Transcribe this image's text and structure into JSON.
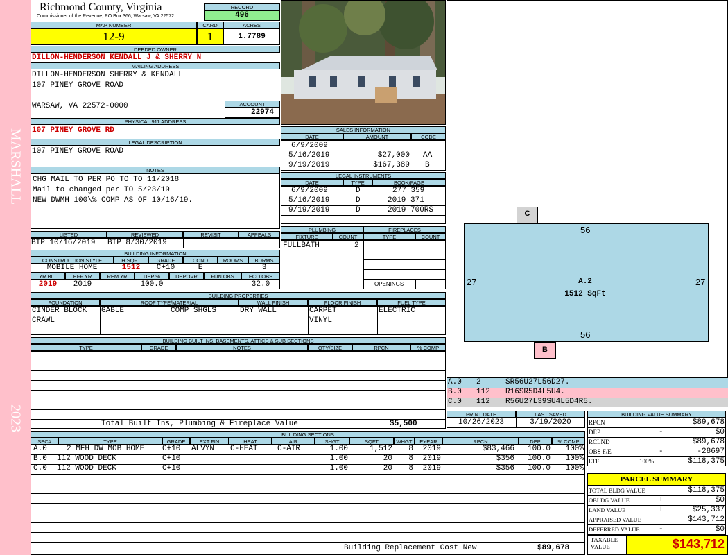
{
  "sidebar": {
    "district": "MARSHALL",
    "year": "2023",
    "color": "#ffc0cb"
  },
  "header": {
    "county": "Richmond County, Virginia",
    "commissioner": "Commissioner of the Revenue, PO Box 366, Warsaw, VA 22572",
    "record_label": "RECORD",
    "record": "496",
    "map_label": "MAP NUMBER",
    "map": "12-9",
    "card_label": "CARD",
    "card": "1",
    "acres_label": "ACRES",
    "acres": "1.7789"
  },
  "owner": {
    "deeded_label": "DEEDED OWNER",
    "deeded": "DILLON-HENDERSON KENDALL J & SHERRY N",
    "mailing_label": "MAILING ADDRESS",
    "line1": "DILLON-HENDERSON SHERRY & KENDALL",
    "line2": "107 PINEY GROVE ROAD",
    "line3": "WARSAW, VA 22572-0000",
    "account_label": "ACCOUNT",
    "account": "22974",
    "physical_label": "PHYSICAL 911 ADDRESS",
    "physical": "107 PINEY GROVE RD",
    "legal_label": "LEGAL DESCRIPTION",
    "legal": "107 PINEY GROVE ROAD"
  },
  "notes": {
    "label": "NOTES",
    "lines": [
      "CHG MAIL TO PER PO TO TO 11/2018",
      "Mail to changed per TO 5/23/19",
      "NEW DWMH 100\\% COMP AS OF 10/16/19."
    ]
  },
  "listing": {
    "listed_label": "LISTED",
    "listed": "BTP 10/16/2019",
    "reviewed_label": "REVIEWED",
    "reviewed": "BTP  8/30/2019",
    "revisit_label": "REVISIT",
    "appeals_label": "APPEALS"
  },
  "building_info": {
    "label": "BUILDING INFORMATION",
    "h1": [
      "CONSTRUCTION STYLE",
      "H SQFT",
      "GRADE",
      "COND",
      "ROOMS",
      "BDRMS"
    ],
    "v1": [
      "MOBILE HOME",
      "1512",
      "C+10",
      "E",
      "",
      "3"
    ],
    "h2": [
      "YR BLT",
      "EFF YR",
      "REM YR",
      "DEP %",
      "DEPOVR",
      "FUN OBS",
      "ECO OBS"
    ],
    "v2": [
      "2019",
      "2019",
      "",
      "100.0",
      "",
      "",
      "32.0"
    ]
  },
  "sales": {
    "label": "SALES INFORMATION",
    "cols": [
      "DATE",
      "AMOUNT",
      "CODE"
    ],
    "rows": [
      [
        "6/9/2009",
        "",
        ""
      ],
      [
        "5/16/2019",
        "$27,000",
        "AA"
      ],
      [
        "9/19/2019",
        "$167,389",
        "B"
      ]
    ]
  },
  "instruments": {
    "label": "LEGAL INSTRUMENTS",
    "cols": [
      "DATE",
      "TYPE",
      "BOOK/PAGE"
    ],
    "rows": [
      [
        "6/9/2009",
        "D",
        "277 359"
      ],
      [
        "5/16/2019",
        "D",
        "2019 371"
      ],
      [
        "9/19/2019",
        "D",
        "2019 700RS"
      ]
    ]
  },
  "plumbing": {
    "label": "PLUMBING",
    "cols": [
      "FIXTURE",
      "COUNT"
    ],
    "fixture": "FULLBATH",
    "count": "2"
  },
  "fireplaces": {
    "label": "FIREPLACES",
    "cols": [
      "TYPE",
      "COUNT"
    ],
    "openings": "OPENINGS"
  },
  "properties": {
    "label": "BUILDING PROPERTIES",
    "cols": [
      "FOUNDATION",
      "ROOF TYPE/MATERIAL",
      "WALL FINISH",
      "FLOOR FINISH",
      "FUEL TYPE"
    ],
    "foundation": [
      "CINDER BLOCK",
      "CRAWL"
    ],
    "roof_type": "GABLE",
    "roof_material": "COMP SHGLS",
    "wall": "DRY WALL",
    "floor": [
      "CARPET",
      "VINYL"
    ],
    "fuel": "ELECTRIC"
  },
  "builtins": {
    "label": "BUILDING BUILT INS, BASEMENTS, ATTICS & SUB SECTIONS",
    "cols": [
      "TYPE",
      "GRADE",
      "NOTES",
      "QTY/SIZE",
      "RPCN",
      "% COMP"
    ],
    "total_label": "Total Built Ins, Plumbing & Fireplace Value",
    "total": "$5,500"
  },
  "sections": {
    "label": "BUILDING SECTIONS",
    "cols": [
      "SEC#",
      "TYPE",
      "GRADE",
      "EXT FIN",
      "HEAT",
      "AIR",
      "SHGT",
      "SQFT",
      "WHGT",
      "EYEAR",
      "RPCN",
      "DEP",
      "% COMP"
    ],
    "rows": [
      [
        "A.0",
        "2 MFH DW MOB HOME",
        "C+10",
        "ALVYN",
        "C-HEAT",
        "C-AIR",
        "1.00",
        "1,512",
        "8",
        "2019",
        "$83,466",
        "100.0",
        "100%"
      ],
      [
        "B.0",
        "112 WOOD DECK",
        "",
        "C+10",
        "",
        "",
        "1.00",
        "20",
        "8",
        "2019",
        "$356",
        "100.0",
        "100%"
      ],
      [
        "C.0",
        "112 WOOD DECK",
        "",
        "C+10",
        "",
        "",
        "1.00",
        "20",
        "8",
        "2019",
        "$356",
        "100.0",
        "100%"
      ]
    ],
    "replacement_label": "Building Replacement Cost New",
    "replacement": "$89,678"
  },
  "sketch": {
    "c_label": "C",
    "b_label": "B",
    "top": "56",
    "bottom": "56",
    "left": "27",
    "right": "27",
    "area": "A.2",
    "sqft": "1512 SqFt",
    "legend": [
      {
        "sec": "A.0",
        "num": "2",
        "code": "SR56U27L56D27."
      },
      {
        "sec": "B.0",
        "num": "112",
        "code": "R16SR5D4L5U4."
      },
      {
        "sec": "C.0",
        "num": "112",
        "code": "R56U27L39SU4L5D4R5."
      }
    ]
  },
  "dates": {
    "print_label": "PRINT DATE",
    "print": "10/26/2023",
    "saved_label": "LAST SAVED",
    "saved": "3/19/2020"
  },
  "value_summary": {
    "label": "BUILDING VALUE SUMMARY",
    "rows": [
      {
        "k": "RPCN",
        "s": "",
        "v": "$89,678"
      },
      {
        "k": "DEP",
        "s": "-",
        "v": "$0"
      },
      {
        "k": "RCLND",
        "s": "",
        "v": "$89,678"
      },
      {
        "k": "OBS F/E",
        "s": "-",
        "v": "-28697"
      },
      {
        "k": "LTF",
        "s": "100%",
        "v": "$118,375"
      }
    ]
  },
  "parcel": {
    "label": "PARCEL SUMMARY",
    "rows": [
      {
        "k": "TOTAL BLDG VALUE",
        "s": "",
        "v": "$118,375"
      },
      {
        "k": "OBLDG VALUE",
        "s": "+",
        "v": "$0"
      },
      {
        "k": "LAND VALUE",
        "s": "+",
        "v": "$25,337"
      },
      {
        "k": "APPRAISED VALUE",
        "s": "",
        "v": "$143,712"
      },
      {
        "k": "DEFERRED VALUE",
        "s": "-",
        "v": "$0"
      }
    ],
    "taxable_label": "TAXABLE VALUE",
    "taxable": "$143,712"
  }
}
